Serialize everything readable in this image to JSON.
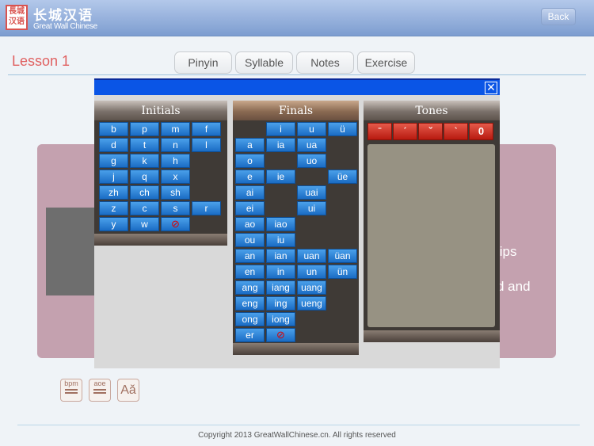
{
  "header": {
    "logo_text": "長城汉语",
    "title_cn": "长城汉语",
    "title_en": "Great Wall Chinese",
    "back": "Back"
  },
  "lesson": "Lesson 1",
  "tabs": [
    "Pinyin",
    "Syllable",
    "Notes",
    "Exercise"
  ],
  "card_fragments": [
    "lips",
    "d and"
  ],
  "tools": [
    {
      "icon": "bpm"
    },
    {
      "icon": "aoe"
    },
    {
      "icon": "Aǎ"
    }
  ],
  "footer": "Copyright 2013 GreatWallChinese.cn. All rights reserved",
  "popup": {
    "close": "☒",
    "initials": {
      "title": "Initials",
      "rows": [
        [
          "b",
          "p",
          "m",
          "f"
        ],
        [
          "d",
          "t",
          "n",
          "l"
        ],
        [
          "g",
          "k",
          "h",
          ""
        ],
        [
          "j",
          "q",
          "x",
          ""
        ],
        [
          "zh",
          "ch",
          "sh",
          ""
        ],
        [
          "z",
          "c",
          "s",
          "r"
        ],
        [
          "y",
          "w",
          "⊘",
          ""
        ]
      ]
    },
    "finals": {
      "title": "Finals",
      "rows": [
        [
          "",
          "i",
          "u",
          "ü"
        ],
        [
          "a",
          "ia",
          "ua",
          ""
        ],
        [
          "o",
          "",
          "uo",
          ""
        ],
        [
          "e",
          "ie",
          "",
          "üe"
        ],
        [
          "ai",
          "",
          "uai",
          ""
        ],
        [
          "ei",
          "",
          "ui",
          ""
        ],
        [
          "ao",
          "iao",
          "",
          ""
        ],
        [
          "ou",
          "iu",
          "",
          ""
        ],
        [
          "an",
          "ian",
          "uan",
          "üan"
        ],
        [
          "en",
          "in",
          "un",
          "ün"
        ],
        [
          "ang",
          "iang",
          "uang",
          ""
        ],
        [
          "eng",
          "ing",
          "ueng",
          ""
        ],
        [
          "ong",
          "iong",
          "",
          ""
        ],
        [
          "er",
          "⊘",
          "",
          ""
        ]
      ]
    },
    "tones": {
      "title": "Tones",
      "buttons": [
        "ˉ",
        "ˊ",
        "ˇ",
        "ˋ",
        "0"
      ]
    }
  }
}
